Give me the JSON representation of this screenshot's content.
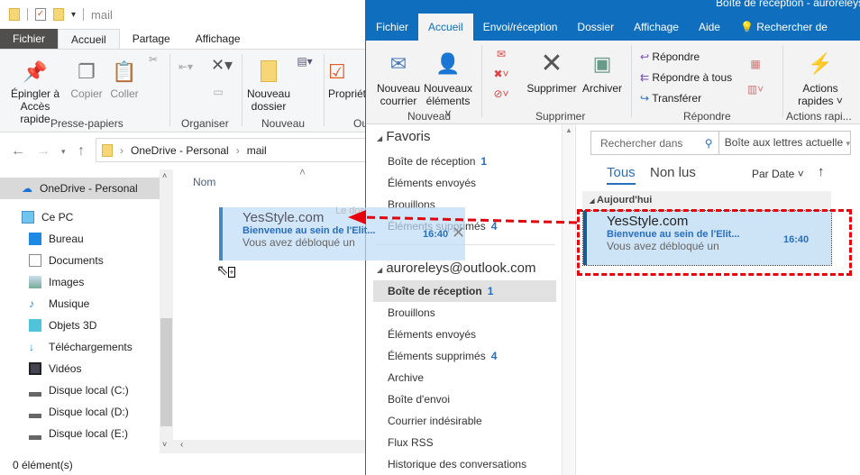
{
  "explorer": {
    "title": "mail",
    "tabs": [
      "Fichier",
      "Accueil",
      "Partage",
      "Affichage"
    ],
    "ribbon": {
      "pin": "Épingler à Accès rapide",
      "copy": "Copier",
      "paste": "Coller",
      "new_folder": "Nouveau dossier",
      "properties": "Propriétés",
      "groups": [
        "Presse-papiers",
        "Organiser",
        "Nouveau",
        "Ou"
      ]
    },
    "breadcrumb": [
      "OneDrive - Personal",
      "mail"
    ],
    "nav": [
      "OneDrive - Personal",
      "Ce PC",
      "Bureau",
      "Documents",
      "Images",
      "Musique",
      "Objets 3D",
      "Téléchargements",
      "Vidéos",
      "Disque local (C:)",
      "Disque local (D:)",
      "Disque local (E:)"
    ],
    "column": "Nom",
    "status": "0 élément(s)"
  },
  "outlook": {
    "title": "Boîte de réception - auroreleys",
    "tabs": [
      "Fichier",
      "Accueil",
      "Envoi/réception",
      "Dossier",
      "Affichage",
      "Aide"
    ],
    "search_tell": "Rechercher de",
    "ribbon": {
      "new_mail": "Nouveau courrier",
      "new_items": "Nouveaux éléments",
      "delete": "Supprimer",
      "archive": "Archiver",
      "reply": "Répondre",
      "reply_all": "Répondre à tous",
      "forward": "Transférer",
      "quick": "Actions rapides",
      "groups": [
        "Nouveau",
        "Supprimer",
        "Répondre",
        "Actions rapi..."
      ]
    },
    "favorites_header": "Favoris",
    "favorites": [
      {
        "name": "Boîte de réception",
        "count": "1"
      },
      {
        "name": "Éléments envoyés"
      },
      {
        "name": "Brouillons"
      },
      {
        "name": "Éléments supprimés",
        "count": "4"
      }
    ],
    "account": "auroreleys@outlook.com",
    "folders": [
      {
        "name": "Boîte de réception",
        "count": "1"
      },
      {
        "name": "Brouillons"
      },
      {
        "name": "Éléments envoyés"
      },
      {
        "name": "Éléments supprimés",
        "count": "4"
      },
      {
        "name": "Archive"
      },
      {
        "name": "Boîte d'envoi"
      },
      {
        "name": "Courrier indésirable"
      },
      {
        "name": "Flux RSS"
      },
      {
        "name": "Historique des conversations"
      }
    ],
    "search_placeholder": "Rechercher dans",
    "scope": "Boîte aux lettres actuelle",
    "filter_all": "Tous",
    "filter_unread": "Non lus",
    "sort": "Par Date",
    "group_today": "Aujourd'hui",
    "message": {
      "from": "YesStyle.com",
      "subject": "Bienvenue au sein de l'Elit...",
      "time": "16:40",
      "preview": "Vous avez débloqué un"
    },
    "ghost_hint": "Le dos"
  },
  "colors": {
    "outlook_blue": "#106ebe",
    "annotation": "#e8000b"
  }
}
